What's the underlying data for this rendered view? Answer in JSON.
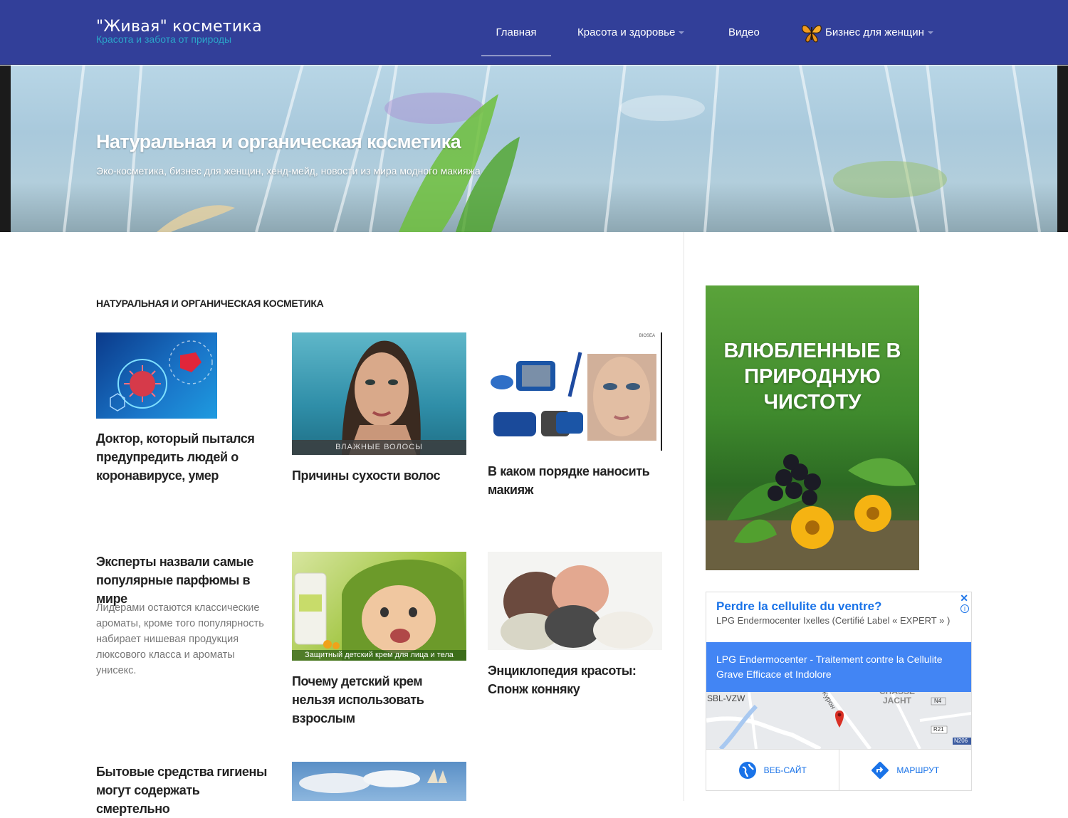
{
  "site": {
    "title": "\"Живая\" косметика",
    "tagline": "Красота и забота от природы"
  },
  "nav": {
    "items": [
      {
        "label": "Главная",
        "active": true
      },
      {
        "label": "Красота и здоровье",
        "dropdown": true
      },
      {
        "label": "Видео"
      },
      {
        "label": "Бизнес для женщин",
        "dropdown": true,
        "icon": "butterfly-icon"
      }
    ]
  },
  "hero": {
    "title": "Натуральная и органическая косметика",
    "subtitle": "Эко-косметика, бизнес для женщин, хенд-мейд, новости из мира модного макияжа"
  },
  "section": {
    "title": "Натуральная и органическая косметика"
  },
  "posts": [
    {
      "title": "Доктор, который пытался предупредить людей о коронавирусе, умер"
    },
    {
      "title": "Причины сухости волос",
      "image_caption": "ВЛАЖНЫЕ ВОЛОСЫ"
    },
    {
      "title": "В каком порядке наносить макияж",
      "image_brand": "BIOSEA"
    },
    {
      "title": "Эксперты назвали самые популярные парфюмы в мире",
      "excerpt": "Лидерами остаются классические ароматы, кроме того популярность набирает нишевая продукция люксового класса и ароматы унисекс."
    },
    {
      "title": "Почему детский крем нельзя использовать взрослым",
      "image_caption": "Защитный детский крем для лица и тела"
    },
    {
      "title": "Энциклопедия красоты: Спонж конняку"
    },
    {
      "title": "Бытовые средства гигиены могут содержать смертельно"
    }
  ],
  "sidebar": {
    "banner": {
      "text": "ВЛЮБЛЕННЫЕ В ПРИРОДНУЮ ЧИСТОТУ"
    },
    "map_ad": {
      "headline": "Perdre la cellulite du ventre?",
      "advertiser": "LPG Endermocenter Ixelles (Certifié Label « EXPERT » )",
      "description": "LPG Endermocenter - Traitement contre la Cellulite Grave Efficace et Indolore",
      "map_labels": [
        "SBL-VZW",
        "CHASSE JACHT",
        "N4",
        "R21",
        "N206",
        "Курон"
      ],
      "website_label": "ВЕБ-САЙТ",
      "route_label": "МАРШРУТ"
    }
  }
}
